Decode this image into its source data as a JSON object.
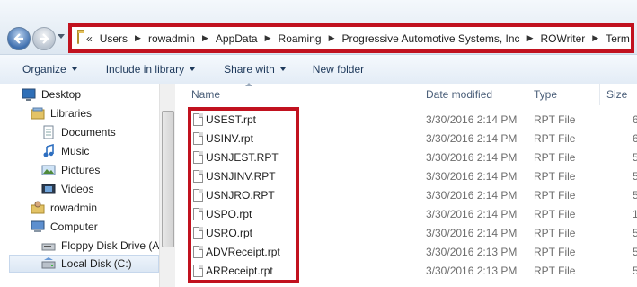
{
  "address": {
    "lead": "«",
    "segments": [
      "Users",
      "rowadmin",
      "AppData",
      "Roaming",
      "Progressive Automotive Systems, Inc",
      "ROWriter",
      "Term"
    ]
  },
  "toolbar": {
    "organize": "Organize",
    "include": "Include in library",
    "share": "Share with",
    "newfolder": "New folder"
  },
  "nav": {
    "items": [
      {
        "label": "Desktop",
        "icon": "desktop-icon"
      },
      {
        "label": "Libraries",
        "icon": "libraries-icon"
      },
      {
        "label": "Documents",
        "icon": "documents-icon"
      },
      {
        "label": "Music",
        "icon": "music-icon"
      },
      {
        "label": "Pictures",
        "icon": "pictures-icon"
      },
      {
        "label": "Videos",
        "icon": "videos-icon"
      },
      {
        "label": "rowadmin",
        "icon": "user-folder-icon"
      },
      {
        "label": "Computer",
        "icon": "computer-icon"
      },
      {
        "label": "Floppy Disk Drive (A:)",
        "icon": "floppy-drive-icon"
      },
      {
        "label": "Local Disk (C:)",
        "icon": "local-disk-icon"
      }
    ]
  },
  "columns": {
    "name": "Name",
    "date": "Date modified",
    "type": "Type",
    "size": "Size"
  },
  "files": [
    {
      "name": "USEST.rpt",
      "date": "3/30/2016 2:14 PM",
      "type": "RPT File",
      "size": "6"
    },
    {
      "name": "USINV.rpt",
      "date": "3/30/2016 2:14 PM",
      "type": "RPT File",
      "size": "6"
    },
    {
      "name": "USNJEST.RPT",
      "date": "3/30/2016 2:14 PM",
      "type": "RPT File",
      "size": "5"
    },
    {
      "name": "USNJINV.RPT",
      "date": "3/30/2016 2:14 PM",
      "type": "RPT File",
      "size": "5"
    },
    {
      "name": "USNJRO.RPT",
      "date": "3/30/2016 2:14 PM",
      "type": "RPT File",
      "size": "5"
    },
    {
      "name": "USPO.rpt",
      "date": "3/30/2016 2:14 PM",
      "type": "RPT File",
      "size": "1"
    },
    {
      "name": "USRO.rpt",
      "date": "3/30/2016 2:14 PM",
      "type": "RPT File",
      "size": "5"
    },
    {
      "name": "ADVReceipt.rpt",
      "date": "3/30/2016 2:13 PM",
      "type": "RPT File",
      "size": "5"
    },
    {
      "name": "ARReceipt.rpt",
      "date": "3/30/2016 2:13 PM",
      "type": "RPT File",
      "size": "5"
    }
  ],
  "colors": {
    "highlight": "#c1121f",
    "accent": "#1e395b"
  }
}
